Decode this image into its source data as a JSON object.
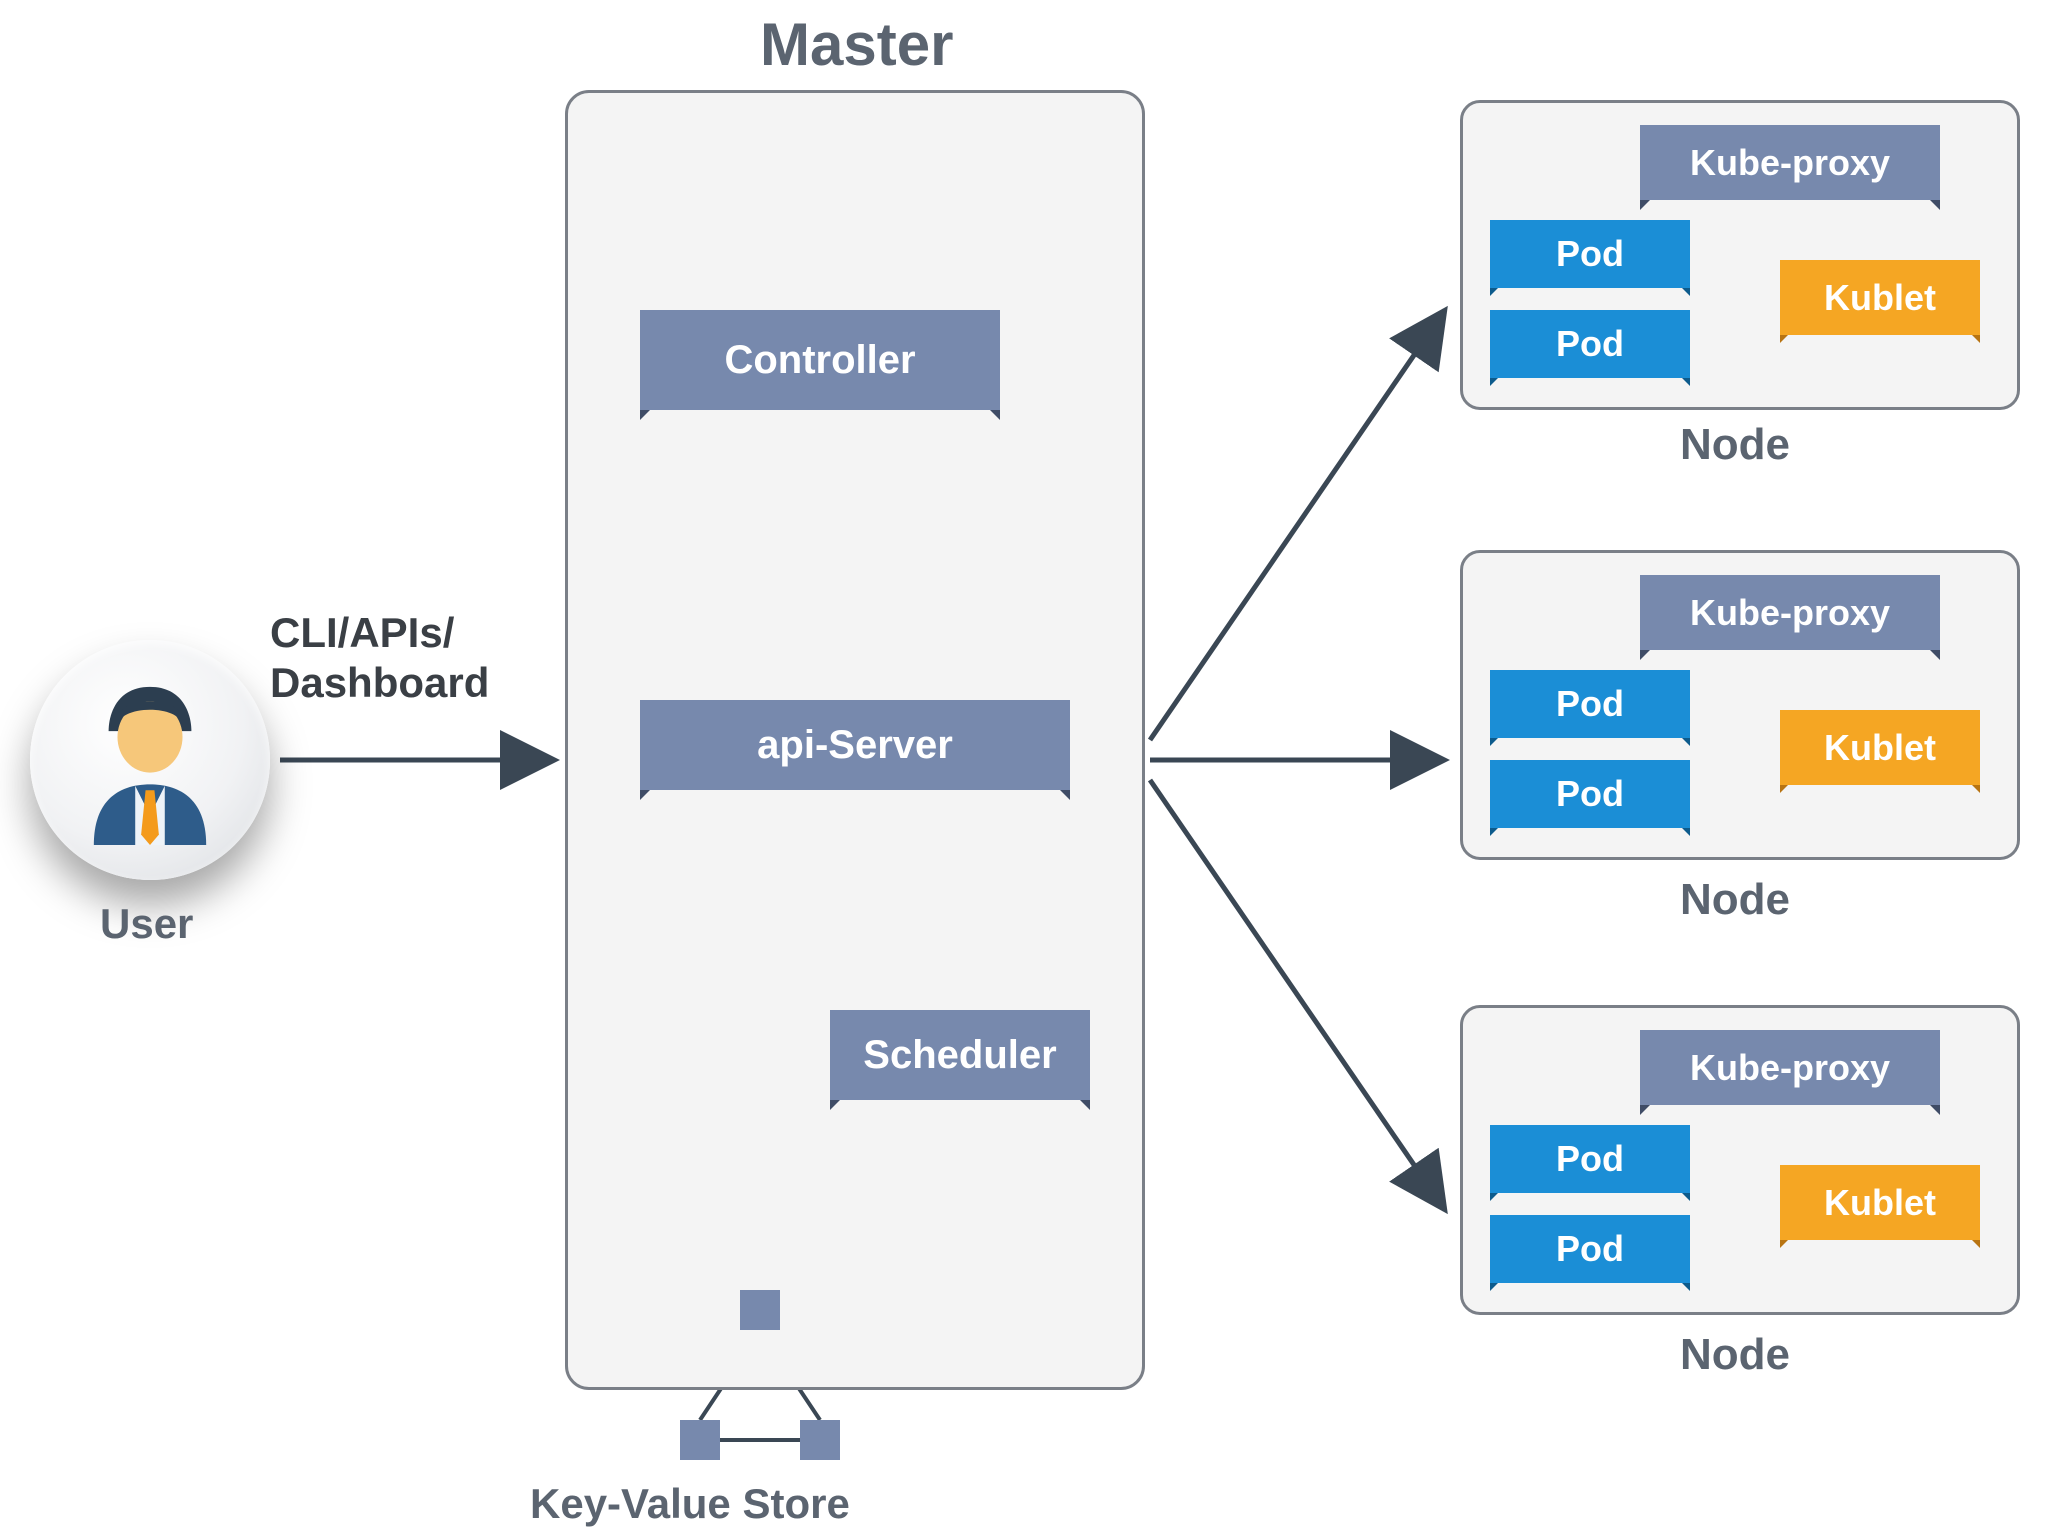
{
  "titles": {
    "master": "Master",
    "user": "User",
    "cli_line1": "CLI/APIs/",
    "cli_line2": "Dashboard",
    "kv_store": "Key-Value Store",
    "node": "Node"
  },
  "master_components": {
    "controller": "Controller",
    "api_server": "api-Server",
    "scheduler": "Scheduler"
  },
  "node_components": {
    "kube_proxy": "Kube-proxy",
    "pod": "Pod",
    "kublet": "Kublet"
  },
  "nodes_count": 3
}
